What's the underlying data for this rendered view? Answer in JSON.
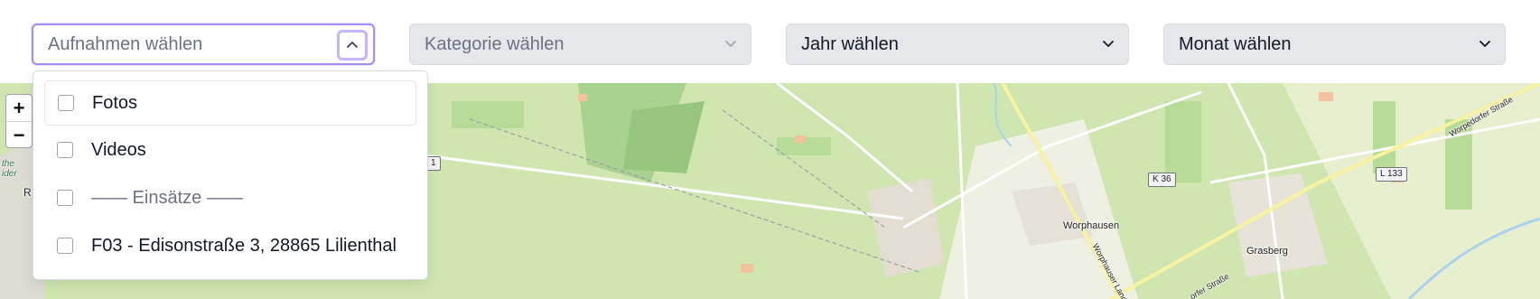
{
  "filters": {
    "recordings": {
      "placeholder": "Aufnahmen wählen"
    },
    "category": {
      "placeholder": "Kategorie wählen"
    },
    "year": {
      "placeholder": "Jahr wählen"
    },
    "month": {
      "placeholder": "Monat wählen"
    }
  },
  "dropdown": {
    "options": [
      {
        "label": "Fotos",
        "checked": false
      },
      {
        "label": "Videos",
        "checked": false
      },
      {
        "label": "—— Einsätze ——",
        "checked": false
      },
      {
        "label": "F03 - Edisonstraße 3, 28865 Lilienthal",
        "checked": false
      }
    ]
  },
  "map": {
    "zoom_in": "+",
    "zoom_out": "−",
    "labels": {
      "worphausen": "Worphausen",
      "grasberg": "Grasberg",
      "worpedorfer_strasse": "Worpedorfer Straße",
      "worphauser_landstrasse": "Worphauser Landstr.",
      "worpedorfer_strasse_2": "orfer Straße",
      "road_k36": "K 36",
      "road_l133": "L 133",
      "road_1": "1",
      "edge_r": "R",
      "edge_text_1": "the",
      "edge_text_2": "ider"
    }
  }
}
